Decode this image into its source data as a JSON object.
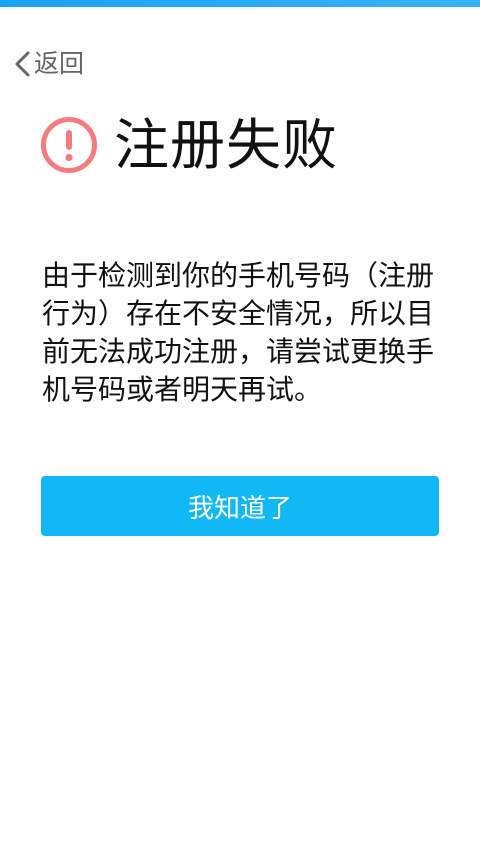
{
  "header": {
    "back_label": "返回",
    "back_icon": "chevron-left-icon"
  },
  "main": {
    "alert_icon": "exclamation-circle-icon",
    "title": "注册失败",
    "message": "由于检测到你的手机号码（注册行为）存在不安全情况，所以目前无法成功注册，请尝试更换手机号码或者明天再试。",
    "confirm_label": "我知道了"
  },
  "colors": {
    "accent": "#12b7f5",
    "alert": "#f47c7c",
    "top_bar": "#1aa3f0",
    "text": "#111111",
    "muted": "#666666"
  }
}
